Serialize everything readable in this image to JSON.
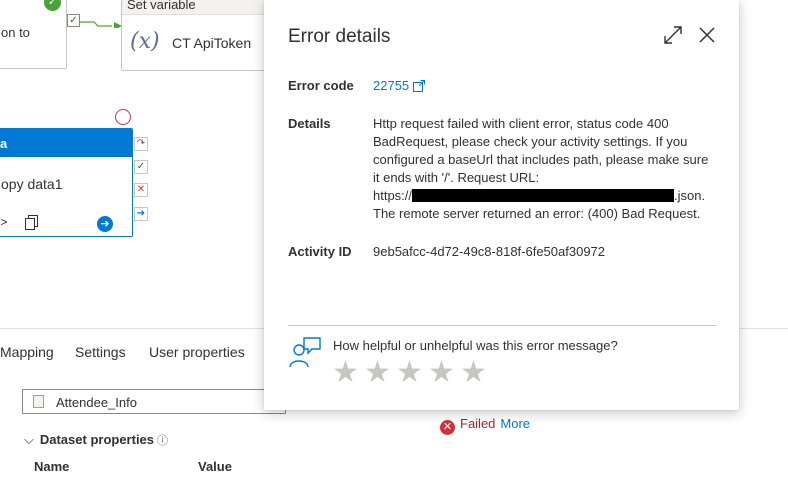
{
  "canvas": {
    "partial_node_label": "on to",
    "set_variable": {
      "header": "Set variable",
      "name": "CT ApiToken",
      "icon": "fx-icon"
    },
    "copy_node": {
      "header": "a",
      "name": "opy data1"
    }
  },
  "bottom_tabs": [
    {
      "label": "Mapping"
    },
    {
      "label": "Settings"
    },
    {
      "label": "User properties"
    }
  ],
  "dataset": {
    "value": "Attendee_Info",
    "properties_label": "Dataset properties",
    "col_name": "Name",
    "col_value": "Value"
  },
  "status": {
    "label": "Failed",
    "more": "More",
    "color": "#d13438"
  },
  "error_panel": {
    "title": "Error details",
    "error_code_label": "Error code",
    "error_code": "22755",
    "details_label": "Details",
    "details_lines": [
      "Http request failed with client error, status code 400",
      "BadRequest, please check your activity settings. If you",
      "configured a baseUrl that includes path, please make sure",
      "it ends with '/'. Request URL:"
    ],
    "details_url_prefix": "https://",
    "details_url_suffix": ".json.",
    "details_last_line": "The remote server returned an error: (400) Bad Request.",
    "activity_id_label": "Activity ID",
    "activity_id": "9eb5afcc-4d72-49c8-818f-6fe50af30972",
    "feedback_question": "How helpful or unhelpful was this error message?",
    "rating_max": 5
  },
  "colors": {
    "accent": "#0078d4",
    "error": "#d13438",
    "success": "#4aa338"
  }
}
